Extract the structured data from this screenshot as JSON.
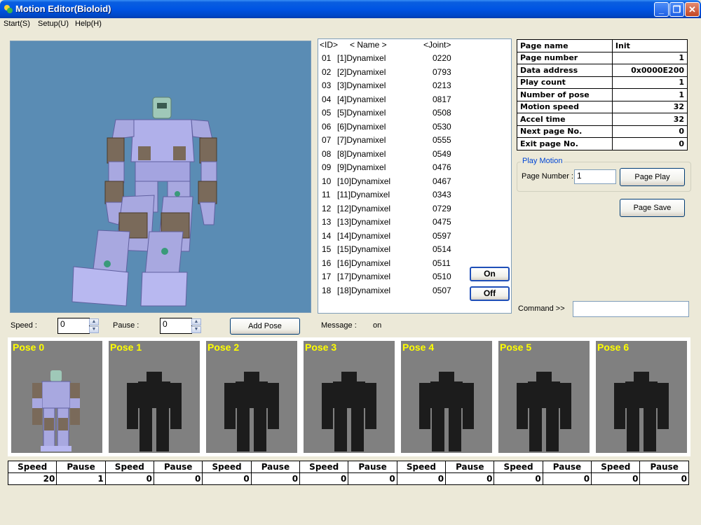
{
  "window": {
    "title": "Motion Editor(Bioloid)",
    "min": "_",
    "max": "❐",
    "close": "✕"
  },
  "menu": [
    "Start(S)",
    "Setup(U)",
    "Help(H)"
  ],
  "joint_list": {
    "headers": {
      "id": "<ID>",
      "name": "< Name >",
      "joint": "<Joint>"
    },
    "rows": [
      {
        "id": "01",
        "name": "[1]Dynamixel",
        "joint": "0220"
      },
      {
        "id": "02",
        "name": "[2]Dynamixel",
        "joint": "0793"
      },
      {
        "id": "03",
        "name": "[3]Dynamixel",
        "joint": "0213"
      },
      {
        "id": "04",
        "name": "[4]Dynamixel",
        "joint": "0817"
      },
      {
        "id": "05",
        "name": "[5]Dynamixel",
        "joint": "0508"
      },
      {
        "id": "06",
        "name": "[6]Dynamixel",
        "joint": "0530"
      },
      {
        "id": "07",
        "name": "[7]Dynamixel",
        "joint": "0555"
      },
      {
        "id": "08",
        "name": "[8]Dynamixel",
        "joint": "0549"
      },
      {
        "id": "09",
        "name": "[9]Dynamixel",
        "joint": "0476"
      },
      {
        "id": "10",
        "name": "[10]Dynamixel",
        "joint": "0467"
      },
      {
        "id": "11",
        "name": "[11]Dynamixel",
        "joint": "0343"
      },
      {
        "id": "12",
        "name": "[12]Dynamixel",
        "joint": "0729"
      },
      {
        "id": "13",
        "name": "[13]Dynamixel",
        "joint": "0475"
      },
      {
        "id": "14",
        "name": "[14]Dynamixel",
        "joint": "0597"
      },
      {
        "id": "15",
        "name": "[15]Dynamixel",
        "joint": "0514"
      },
      {
        "id": "16",
        "name": "[16]Dynamixel",
        "joint": "0511"
      },
      {
        "id": "17",
        "name": "[17]Dynamixel",
        "joint": "0510"
      },
      {
        "id": "18",
        "name": "[18]Dynamixel",
        "joint": "0507"
      }
    ]
  },
  "buttons": {
    "on": "On",
    "off": "Off",
    "add_pose": "Add Pose",
    "page_play": "Page Play",
    "page_save": "Page Save"
  },
  "page_info": [
    {
      "label": "Page name",
      "value": "Init",
      "align": "left"
    },
    {
      "label": "Page number",
      "value": "1"
    },
    {
      "label": "Data address",
      "value": "0x0000E200"
    },
    {
      "label": "Play count",
      "value": "1"
    },
    {
      "label": "Number of pose",
      "value": "1"
    },
    {
      "label": "Motion speed",
      "value": "32"
    },
    {
      "label": "Accel time",
      "value": "32"
    },
    {
      "label": "Next page No.",
      "value": "0"
    },
    {
      "label": "Exit page No.",
      "value": "0"
    }
  ],
  "play_motion": {
    "legend": "Play Motion",
    "page_number_label": "Page Number :",
    "page_number_value": "1"
  },
  "command": {
    "label": "Command >>",
    "value": ""
  },
  "controls": {
    "speed_label": "Speed :",
    "speed_value": "0",
    "pause_label": "Pause :",
    "pause_value": "0",
    "message_label": "Message :",
    "message_value": "on"
  },
  "poses": [
    {
      "label": "Pose 0",
      "speed_header": "Speed",
      "pause_header": "Pause",
      "speed": "20",
      "pause": "1",
      "active": true
    },
    {
      "label": "Pose 1",
      "speed_header": "Speed",
      "pause_header": "Pause",
      "speed": "0",
      "pause": "0",
      "active": false
    },
    {
      "label": "Pose 2",
      "speed_header": "Speed",
      "pause_header": "Pause",
      "speed": "0",
      "pause": "0",
      "active": false
    },
    {
      "label": "Pose 3",
      "speed_header": "Speed",
      "pause_header": "Pause",
      "speed": "0",
      "pause": "0",
      "active": false
    },
    {
      "label": "Pose 4",
      "speed_header": "Speed",
      "pause_header": "Pause",
      "speed": "0",
      "pause": "0",
      "active": false
    },
    {
      "label": "Pose 5",
      "speed_header": "Speed",
      "pause_header": "Pause",
      "speed": "0",
      "pause": "0",
      "active": false
    },
    {
      "label": "Pose 6",
      "speed_header": "Speed",
      "pause_header": "Pause",
      "speed": "0",
      "pause": "0",
      "active": false
    }
  ],
  "colors": {
    "viewport_bg": "#5a8cb4",
    "robot_body": "#a8a8e0",
    "robot_servo": "#7a6a5a",
    "pose_bg": "#808080",
    "pose_label": "#ffff00",
    "inactive_robot": "#1c1c1c"
  }
}
